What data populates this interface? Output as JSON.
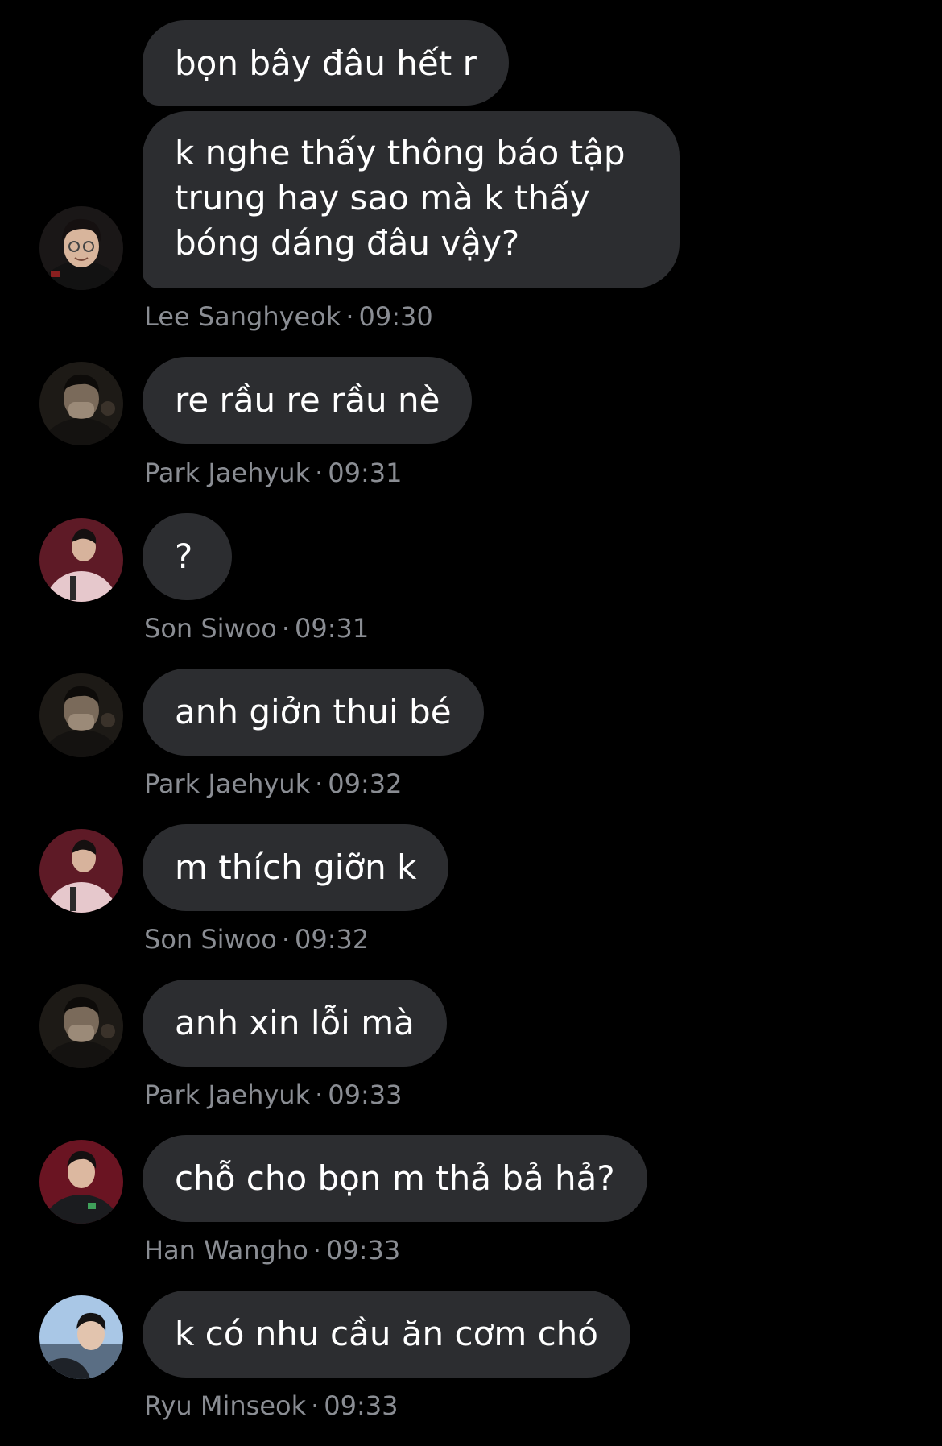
{
  "messages": [
    {
      "text": "bọn bây đâu hết r"
    },
    {
      "text": "k nghe thấy thông báo tập trung hay sao mà k thấy bóng dáng đâu vậy?",
      "sender": "Lee Sanghyeok",
      "time": "09:30"
    },
    {
      "text": "re rầu re rầu nè",
      "sender": "Park Jaehyuk",
      "time": "09:31"
    },
    {
      "text": "?",
      "sender": "Son Siwoo",
      "time": "09:31"
    },
    {
      "text": "anh giởn thui bé",
      "sender": "Park Jaehyuk",
      "time": "09:32"
    },
    {
      "text": "m thích giỡn k",
      "sender": "Son Siwoo",
      "time": "09:32"
    },
    {
      "text": "anh xin lỗi mà",
      "sender": "Park Jaehyuk",
      "time": "09:33"
    },
    {
      "text": "chỗ cho bọn m thả bả hả?",
      "sender": "Han Wangho",
      "time": "09:33"
    },
    {
      "text": "k có nhu cầu ăn cơm chó",
      "sender": "Ryu Minseok",
      "time": "09:33"
    }
  ],
  "separator": "·",
  "colors": {
    "background": "#000000",
    "bubble": "#2c2d30",
    "bubble_text": "#ffffff",
    "meta_text": "#8a8d93"
  },
  "avatars": {
    "lee_sanghyeok": "avatar-lee-sanghyeok",
    "park_jaehyuk": "avatar-park-jaehyuk",
    "son_siwoo": "avatar-son-siwoo",
    "han_wangho": "avatar-han-wangho",
    "ryu_minseok": "avatar-ryu-minseok"
  }
}
